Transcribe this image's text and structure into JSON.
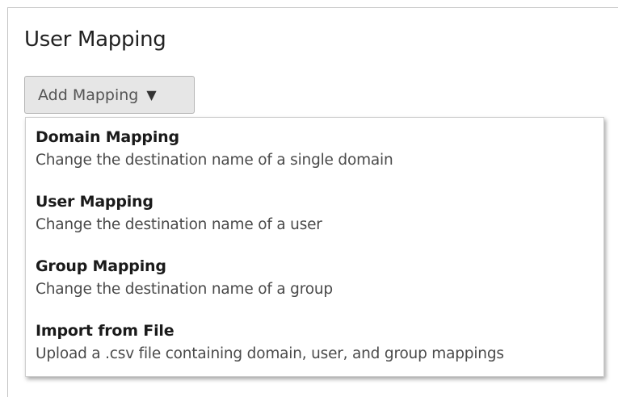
{
  "page": {
    "title": "User Mapping"
  },
  "add_button": {
    "label": "Add Mapping",
    "caret_icon": "triangle-down-icon"
  },
  "menu": {
    "items": [
      {
        "title": "Domain Mapping",
        "description": "Change the destination name of a single domain"
      },
      {
        "title": "User Mapping",
        "description": "Change the destination name of a user"
      },
      {
        "title": "Group Mapping",
        "description": "Change the destination name of a group"
      },
      {
        "title": "Import from File",
        "description": "Upload a .csv file containing domain, user, and group mappings"
      }
    ]
  },
  "colors": {
    "title_text": "#222222",
    "button_bg": "#e6e6e6",
    "button_border": "#b4b4b4",
    "menu_border": "#cfcfcf"
  }
}
